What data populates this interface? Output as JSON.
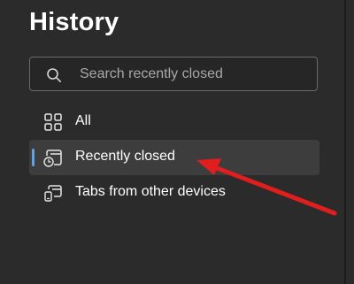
{
  "panel": {
    "title": "History"
  },
  "search": {
    "placeholder": "Search recently closed",
    "icon": "search-icon"
  },
  "nav": {
    "items": [
      {
        "label": "All",
        "icon": "grid-icon",
        "selected": false
      },
      {
        "label": "Recently closed",
        "icon": "recently-closed-icon",
        "selected": true
      },
      {
        "label": "Tabs from other devices",
        "icon": "other-devices-icon",
        "selected": false
      }
    ]
  },
  "colors": {
    "background": "#2b2b2b",
    "selected_background": "#3d3d3d",
    "accent": "#5fa3e0",
    "annotation_arrow": "#e01e1e"
  }
}
